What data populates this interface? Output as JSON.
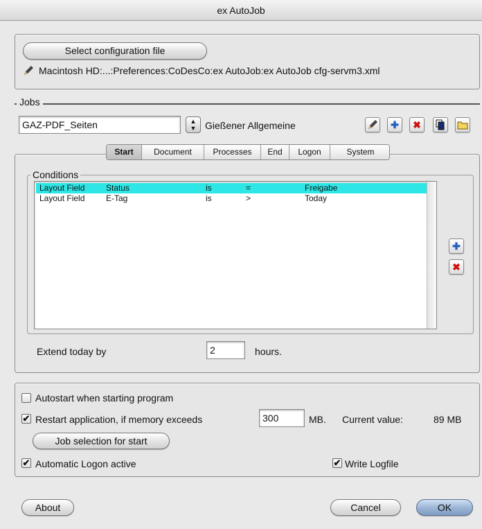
{
  "window": {
    "title": "ex AutoJob"
  },
  "config": {
    "select_button": "Select configuration file",
    "path": "Macintosh HD:...:Preferences:CoDesCo:ex AutoJob:ex AutoJob cfg-servm3.xml"
  },
  "jobs": {
    "group_label": "Jobs",
    "job_name": "GAZ-PDF_Seiten",
    "selected_job": "Gießener Allgemeine",
    "tabs": [
      "Start",
      "Document",
      "Processes",
      "End",
      "Logon",
      "System"
    ],
    "active_tab": "Start",
    "conditions": {
      "label": "Conditions",
      "rows": [
        {
          "type": "Layout Field",
          "field": "Status",
          "op1": "is",
          "op2": "=",
          "value": "Freigabe"
        },
        {
          "type": "Layout Field",
          "field": "E-Tag",
          "op1": "is",
          "op2": ">",
          "value": "Today"
        }
      ]
    },
    "extend": {
      "label": "Extend today by",
      "value": "2",
      "unit": "hours."
    }
  },
  "options": {
    "autostart_label": "Autostart when starting program",
    "autostart_checked": false,
    "restart_label": "Restart application, if memory exceeds",
    "restart_checked": true,
    "memory_value": "300",
    "memory_unit": "MB.",
    "current_label": "Current value:",
    "current_value": "89 MB",
    "job_selection_button": "Job selection for start",
    "logon_label": "Automatic Logon active",
    "logon_checked": true,
    "logfile_label": "Write Logfile",
    "logfile_checked": true
  },
  "footer": {
    "about": "About",
    "cancel": "Cancel",
    "ok": "OK"
  },
  "colors": {
    "selection": "#2ee6e6",
    "delete_red": "#d01010",
    "add_blue": "#1f5fbf"
  }
}
